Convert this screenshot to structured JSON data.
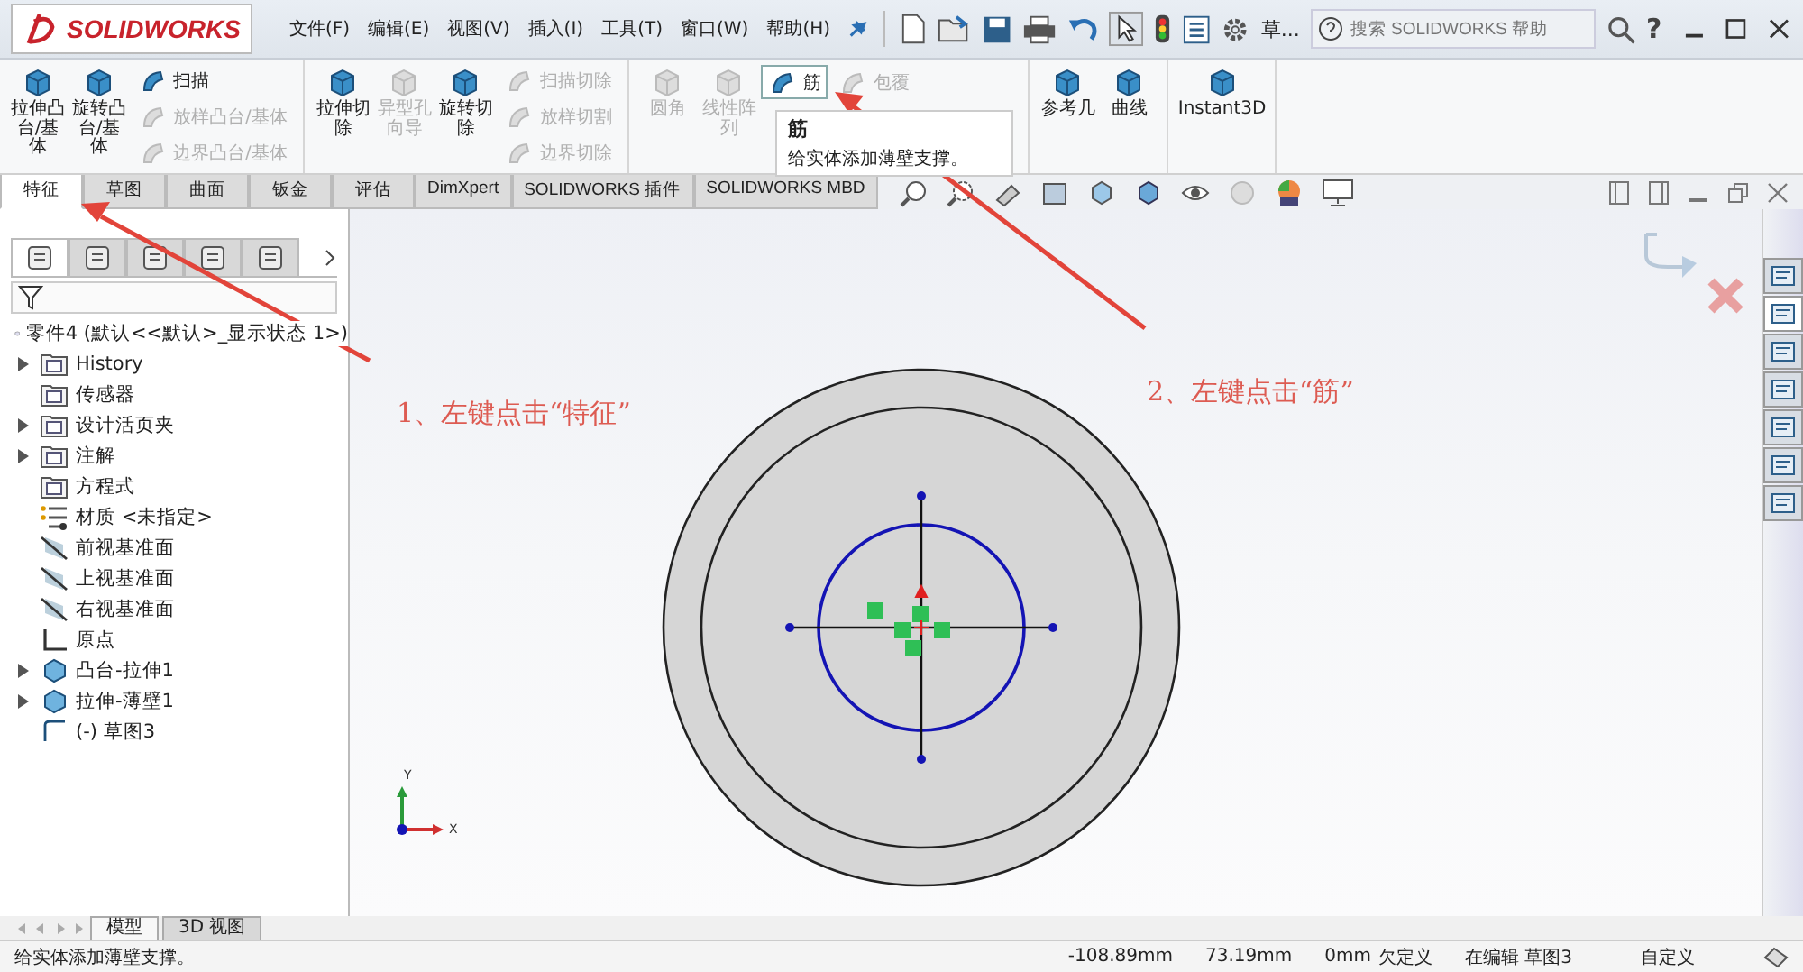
{
  "app_name": "SOLIDWORKS",
  "menu": [
    "文件(F)",
    "编辑(E)",
    "视图(V)",
    "插入(I)",
    "工具(T)",
    "窗口(W)",
    "帮助(H)"
  ],
  "quick_access_more": "草...",
  "search": {
    "placeholder": "搜索 SOLIDWORKS 帮助"
  },
  "help_glyph": "?",
  "ribbon": {
    "groups": [
      {
        "large": [
          {
            "label": "拉伸凸台/基体",
            "disabled": false
          },
          {
            "label": "旋转凸台/基体",
            "disabled": false
          }
        ],
        "small_columns": [
          [
            {
              "label": "扫描",
              "disabled": false,
              "hovered": false
            },
            {
              "label": "放样凸台/基体",
              "disabled": true,
              "hovered": false
            },
            {
              "label": "边界凸台/基体",
              "disabled": true,
              "hovered": false
            }
          ]
        ]
      },
      {
        "large": [
          {
            "label": "拉伸切除",
            "disabled": false
          },
          {
            "label": "异型孔向导",
            "disabled": true
          },
          {
            "label": "旋转切除",
            "disabled": false
          }
        ],
        "small_columns": [
          [
            {
              "label": "扫描切除",
              "disabled": true,
              "hovered": false
            },
            {
              "label": "放样切割",
              "disabled": true,
              "hovered": false
            },
            {
              "label": "边界切除",
              "disabled": true,
              "hovered": false
            }
          ]
        ]
      },
      {
        "large": [
          {
            "label": "圆角",
            "disabled": true
          },
          {
            "label": "线性阵列",
            "disabled": true
          }
        ],
        "small_columns": [
          [
            {
              "label": "筋",
              "disabled": false,
              "hovered": true
            }
          ],
          [
            {
              "label": "包覆",
              "disabled": true,
              "hovered": false
            }
          ]
        ]
      },
      {
        "large": [
          {
            "label": "参考几",
            "disabled": false
          },
          {
            "label": "曲线",
            "disabled": false
          }
        ]
      },
      {
        "large": [
          {
            "label": "Instant3D",
            "disabled": false
          }
        ]
      }
    ]
  },
  "tooltip": {
    "title": "筋",
    "description": "给实体添加薄壁支撑。"
  },
  "tabs": [
    {
      "label": "特征",
      "selected": true
    },
    {
      "label": "草图",
      "selected": false
    },
    {
      "label": "曲面",
      "selected": false
    },
    {
      "label": "钣金",
      "selected": false
    },
    {
      "label": "评估",
      "selected": false
    },
    {
      "label": "DimXpert",
      "selected": false
    },
    {
      "label": "SOLIDWORKS 插件",
      "selected": false
    },
    {
      "label": "SOLIDWORKS MBD",
      "selected": false
    }
  ],
  "panel_tabs": [
    {
      "selected": true
    },
    {
      "selected": false
    },
    {
      "selected": false
    },
    {
      "selected": false
    },
    {
      "selected": false
    }
  ],
  "feature_tree": {
    "root": "零件4  (默认<<默认>_显示状态 1>)",
    "items": [
      {
        "label": "History",
        "kind": "history",
        "expandable": true
      },
      {
        "label": "传感器",
        "kind": "sensor",
        "expandable": false
      },
      {
        "label": "设计活页夹",
        "kind": "folder",
        "expandable": true
      },
      {
        "label": "注解",
        "kind": "annotation",
        "expandable": true
      },
      {
        "label": "方程式",
        "kind": "equation",
        "expandable": false
      },
      {
        "label": "材质 <未指定>",
        "kind": "material",
        "expandable": false
      },
      {
        "label": "前视基准面",
        "kind": "plane",
        "expandable": false
      },
      {
        "label": "上视基准面",
        "kind": "plane",
        "expandable": false
      },
      {
        "label": "右视基准面",
        "kind": "plane",
        "expandable": false
      },
      {
        "label": "原点",
        "kind": "origin",
        "expandable": false
      },
      {
        "label": "凸台-拉伸1",
        "kind": "feature",
        "expandable": true
      },
      {
        "label": "拉伸-薄壁1",
        "kind": "feature",
        "expandable": true
      },
      {
        "label": "(-) 草图3",
        "kind": "sketch",
        "expandable": false
      }
    ]
  },
  "annotations": [
    {
      "text": "1、左键点击“特征”"
    },
    {
      "text": "2、左键点击“筋”"
    }
  ],
  "triad": {
    "y_label": "Y",
    "x_label": "X"
  },
  "task_pane": [
    {
      "selected": false
    },
    {
      "selected": true
    },
    {
      "selected": false
    },
    {
      "selected": false
    },
    {
      "selected": false
    },
    {
      "selected": false
    },
    {
      "selected": false
    }
  ],
  "bottom_tabs": [
    {
      "label": "模型",
      "selected": true
    },
    {
      "label": "3D 视图",
      "selected": false
    }
  ],
  "status_bar": {
    "message": "给实体添加薄壁支撑。",
    "x": "-108.89mm",
    "y": "73.19mm",
    "z": "0mm",
    "state": "欠定义",
    "editing": "在编辑 草图3",
    "units": "自定义"
  }
}
